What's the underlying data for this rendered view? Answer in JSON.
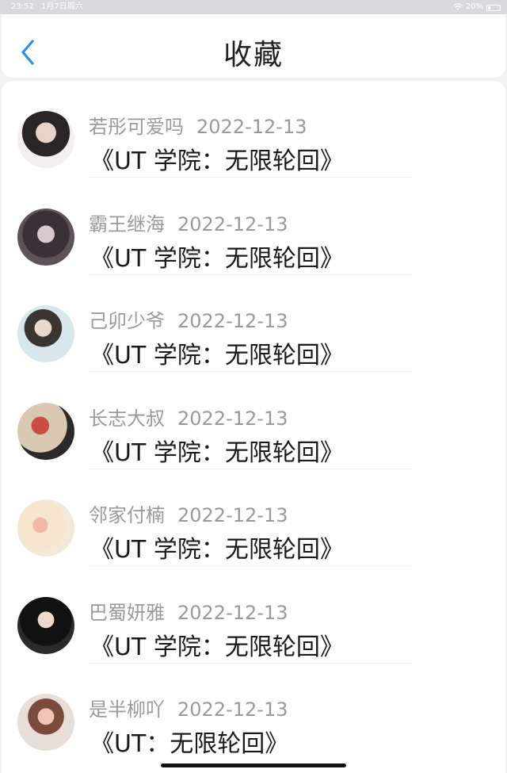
{
  "status_bar": {
    "time": "23:52",
    "date": "1月7日周六",
    "battery": "20%",
    "battery_level": 0.2
  },
  "header": {
    "title": "收藏",
    "back_icon": "chevron-left-icon",
    "accent_color": "#2f8fe0"
  },
  "favorites": [
    {
      "user": "若彤可爱吗",
      "date": "2022-12-13",
      "title": "《UT 学院：无限轮回》",
      "avatar_icon": "avatar-photo"
    },
    {
      "user": "霸王继海",
      "date": "2022-12-13",
      "title": "《UT 学院：无限轮回》",
      "avatar_icon": "avatar-photo"
    },
    {
      "user": "己卯少爷",
      "date": "2022-12-13",
      "title": "《UT 学院：无限轮回》",
      "avatar_icon": "avatar-photo"
    },
    {
      "user": "长志大叔",
      "date": "2022-12-13",
      "title": "《UT 学院：无限轮回》",
      "avatar_icon": "avatar-photo"
    },
    {
      "user": "邻家付楠",
      "date": "2022-12-13",
      "title": "《UT 学院：无限轮回》",
      "avatar_icon": "avatar-photo"
    },
    {
      "user": "巴蜀妍雅",
      "date": "2022-12-13",
      "title": "《UT 学院：无限轮回》",
      "avatar_icon": "avatar-photo"
    },
    {
      "user": "是半柳吖",
      "date": "2022-12-13",
      "title": "《UT：无限轮回》",
      "avatar_icon": "avatar-photo"
    }
  ]
}
